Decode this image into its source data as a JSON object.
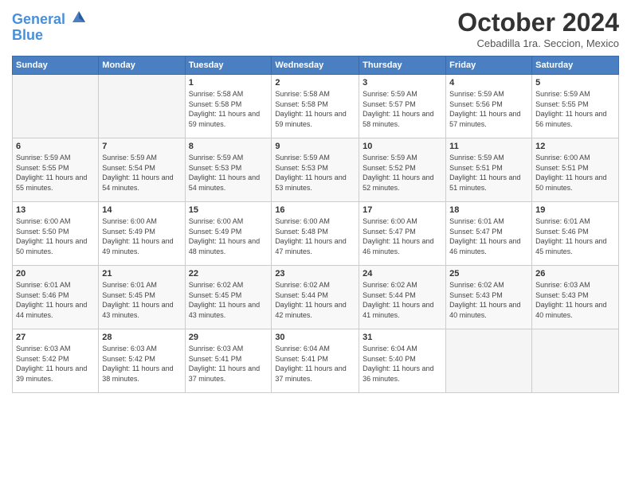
{
  "header": {
    "logo_line1": "General",
    "logo_line2": "Blue",
    "month": "October 2024",
    "location": "Cebadilla 1ra. Seccion, Mexico"
  },
  "weekdays": [
    "Sunday",
    "Monday",
    "Tuesday",
    "Wednesday",
    "Thursday",
    "Friday",
    "Saturday"
  ],
  "weeks": [
    [
      {
        "day": "",
        "info": ""
      },
      {
        "day": "",
        "info": ""
      },
      {
        "day": "1",
        "info": "Sunrise: 5:58 AM\nSunset: 5:58 PM\nDaylight: 11 hours and 59 minutes."
      },
      {
        "day": "2",
        "info": "Sunrise: 5:58 AM\nSunset: 5:58 PM\nDaylight: 11 hours and 59 minutes."
      },
      {
        "day": "3",
        "info": "Sunrise: 5:59 AM\nSunset: 5:57 PM\nDaylight: 11 hours and 58 minutes."
      },
      {
        "day": "4",
        "info": "Sunrise: 5:59 AM\nSunset: 5:56 PM\nDaylight: 11 hours and 57 minutes."
      },
      {
        "day": "5",
        "info": "Sunrise: 5:59 AM\nSunset: 5:55 PM\nDaylight: 11 hours and 56 minutes."
      }
    ],
    [
      {
        "day": "6",
        "info": "Sunrise: 5:59 AM\nSunset: 5:55 PM\nDaylight: 11 hours and 55 minutes."
      },
      {
        "day": "7",
        "info": "Sunrise: 5:59 AM\nSunset: 5:54 PM\nDaylight: 11 hours and 54 minutes."
      },
      {
        "day": "8",
        "info": "Sunrise: 5:59 AM\nSunset: 5:53 PM\nDaylight: 11 hours and 54 minutes."
      },
      {
        "day": "9",
        "info": "Sunrise: 5:59 AM\nSunset: 5:53 PM\nDaylight: 11 hours and 53 minutes."
      },
      {
        "day": "10",
        "info": "Sunrise: 5:59 AM\nSunset: 5:52 PM\nDaylight: 11 hours and 52 minutes."
      },
      {
        "day": "11",
        "info": "Sunrise: 5:59 AM\nSunset: 5:51 PM\nDaylight: 11 hours and 51 minutes."
      },
      {
        "day": "12",
        "info": "Sunrise: 6:00 AM\nSunset: 5:51 PM\nDaylight: 11 hours and 50 minutes."
      }
    ],
    [
      {
        "day": "13",
        "info": "Sunrise: 6:00 AM\nSunset: 5:50 PM\nDaylight: 11 hours and 50 minutes."
      },
      {
        "day": "14",
        "info": "Sunrise: 6:00 AM\nSunset: 5:49 PM\nDaylight: 11 hours and 49 minutes."
      },
      {
        "day": "15",
        "info": "Sunrise: 6:00 AM\nSunset: 5:49 PM\nDaylight: 11 hours and 48 minutes."
      },
      {
        "day": "16",
        "info": "Sunrise: 6:00 AM\nSunset: 5:48 PM\nDaylight: 11 hours and 47 minutes."
      },
      {
        "day": "17",
        "info": "Sunrise: 6:00 AM\nSunset: 5:47 PM\nDaylight: 11 hours and 46 minutes."
      },
      {
        "day": "18",
        "info": "Sunrise: 6:01 AM\nSunset: 5:47 PM\nDaylight: 11 hours and 46 minutes."
      },
      {
        "day": "19",
        "info": "Sunrise: 6:01 AM\nSunset: 5:46 PM\nDaylight: 11 hours and 45 minutes."
      }
    ],
    [
      {
        "day": "20",
        "info": "Sunrise: 6:01 AM\nSunset: 5:46 PM\nDaylight: 11 hours and 44 minutes."
      },
      {
        "day": "21",
        "info": "Sunrise: 6:01 AM\nSunset: 5:45 PM\nDaylight: 11 hours and 43 minutes."
      },
      {
        "day": "22",
        "info": "Sunrise: 6:02 AM\nSunset: 5:45 PM\nDaylight: 11 hours and 43 minutes."
      },
      {
        "day": "23",
        "info": "Sunrise: 6:02 AM\nSunset: 5:44 PM\nDaylight: 11 hours and 42 minutes."
      },
      {
        "day": "24",
        "info": "Sunrise: 6:02 AM\nSunset: 5:44 PM\nDaylight: 11 hours and 41 minutes."
      },
      {
        "day": "25",
        "info": "Sunrise: 6:02 AM\nSunset: 5:43 PM\nDaylight: 11 hours and 40 minutes."
      },
      {
        "day": "26",
        "info": "Sunrise: 6:03 AM\nSunset: 5:43 PM\nDaylight: 11 hours and 40 minutes."
      }
    ],
    [
      {
        "day": "27",
        "info": "Sunrise: 6:03 AM\nSunset: 5:42 PM\nDaylight: 11 hours and 39 minutes."
      },
      {
        "day": "28",
        "info": "Sunrise: 6:03 AM\nSunset: 5:42 PM\nDaylight: 11 hours and 38 minutes."
      },
      {
        "day": "29",
        "info": "Sunrise: 6:03 AM\nSunset: 5:41 PM\nDaylight: 11 hours and 37 minutes."
      },
      {
        "day": "30",
        "info": "Sunrise: 6:04 AM\nSunset: 5:41 PM\nDaylight: 11 hours and 37 minutes."
      },
      {
        "day": "31",
        "info": "Sunrise: 6:04 AM\nSunset: 5:40 PM\nDaylight: 11 hours and 36 minutes."
      },
      {
        "day": "",
        "info": ""
      },
      {
        "day": "",
        "info": ""
      }
    ]
  ]
}
